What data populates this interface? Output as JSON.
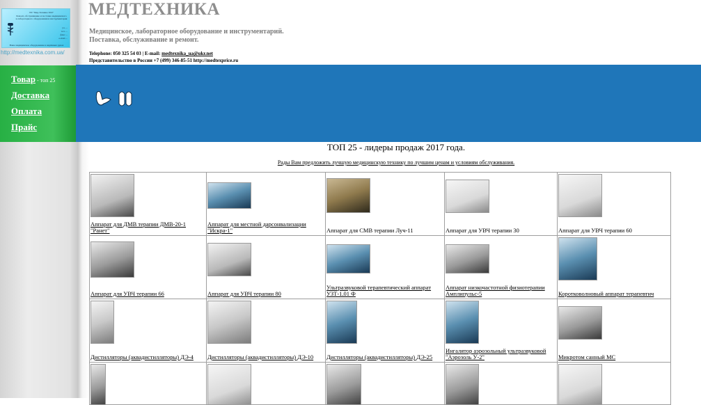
{
  "logo": {
    "lines_top": [
      "ТП \"Мед-Техника ХХI\"",
      "Ремонт, обслуживание и поставка медицинского",
      "и лабораторного оборудования и инструментария"
    ],
    "lines_bottom": [
      "ул. ... ",
      "тел. ...",
      "факс ...",
      "e-mail ..."
    ],
    "footer_line": "Ваше медицинское оборудование в надёжных руках"
  },
  "site_url": "http://medtexnika.com.ua/",
  "nav": {
    "items": [
      {
        "label": "Товар",
        "sub": " - топ 25"
      },
      {
        "label": "Доставка"
      },
      {
        "label": "Оплата"
      },
      {
        "label": "Прайс"
      }
    ]
  },
  "header": {
    "title": "МЕДТЕХНИКА",
    "tagline_1": "Медицинское, лабораторное оборудование и инструментарий.",
    "tagline_2": "Поставка, обслуживание и ремонт.",
    "phone_prefix": "Telephone: 050 325 54 03  |  E-mail: ",
    "email": "medtexnika_ua@ukr.net",
    "russia_line": "Представительство в России +7 (499) 346-85-51 http://medtexprice.ru"
  },
  "content": {
    "title": "ТОП 25 - лидеры продаж 2017 года.",
    "intro": "Рады Вам предложить лучшую медицинскую технику по лучшим ценам и условиям обслуживания."
  },
  "products": [
    [
      {
        "name": "Аппарат для ДМВ терапии ДМВ-20-1 \"Ранет\"",
        "icon": "device-image",
        "link": true
      },
      {
        "name": "Аппарат для местной дарсонвализации \"Искра-1\"",
        "icon": "device-image",
        "link": true
      },
      {
        "name": "Аппарат для СМВ терапии Луч-11",
        "icon": "device-image",
        "link": false
      },
      {
        "name": "Аппарат для УВЧ терапии 30",
        "icon": "device-image",
        "link": false
      },
      {
        "name": "Аппарат для УВЧ терапии 60",
        "icon": "device-image",
        "link": false
      }
    ],
    [
      {
        "name": "Аппарат для УВЧ терапии 66",
        "icon": "device-image",
        "link": true
      },
      {
        "name": "Аппарат для УВЧ терапии 80",
        "icon": "device-image",
        "link": true
      },
      {
        "name": "Ультразвуковой терапевтический аппарат УЗТ-1.01 Ф",
        "icon": "device-image",
        "link": true
      },
      {
        "name": "Аппарат низкочастотной физиотерапии Амплипульс-5",
        "icon": "device-image",
        "link": true
      },
      {
        "name": "Коротко­волновый аппарат терапевтич",
        "icon": "device-image",
        "link": true
      }
    ],
    [
      {
        "name": "Дистилляторы (аквадистилляторы) ДЭ-4",
        "icon": "device-image",
        "link": true
      },
      {
        "name": "Дистилляторы (аквадистилляторы) ДЭ-10",
        "icon": "device-image",
        "link": true
      },
      {
        "name": "Дистилляторы (аквадистилляторы) ДЭ-25",
        "icon": "device-image",
        "link": true
      },
      {
        "name": "Ингалятор аэрозольный ультразвуковой \"Аэрозоль У-2\"",
        "icon": "device-image",
        "link": true
      },
      {
        "name": "Микротом санный МС",
        "icon": "device-image",
        "link": true
      }
    ],
    [
      {
        "name": "",
        "icon": "device-image",
        "link": false
      },
      {
        "name": "",
        "icon": "device-image",
        "link": false
      },
      {
        "name": "",
        "icon": "device-image",
        "link": false
      },
      {
        "name": "",
        "icon": "device-image",
        "link": false
      },
      {
        "name": "",
        "icon": "device-image",
        "link": false
      }
    ]
  ],
  "colors": {
    "nav_green": "#27b044",
    "banner_blue": "#1f76b9",
    "title_grey": "#8e8e8e",
    "url_blue": "#4aa2c6"
  }
}
